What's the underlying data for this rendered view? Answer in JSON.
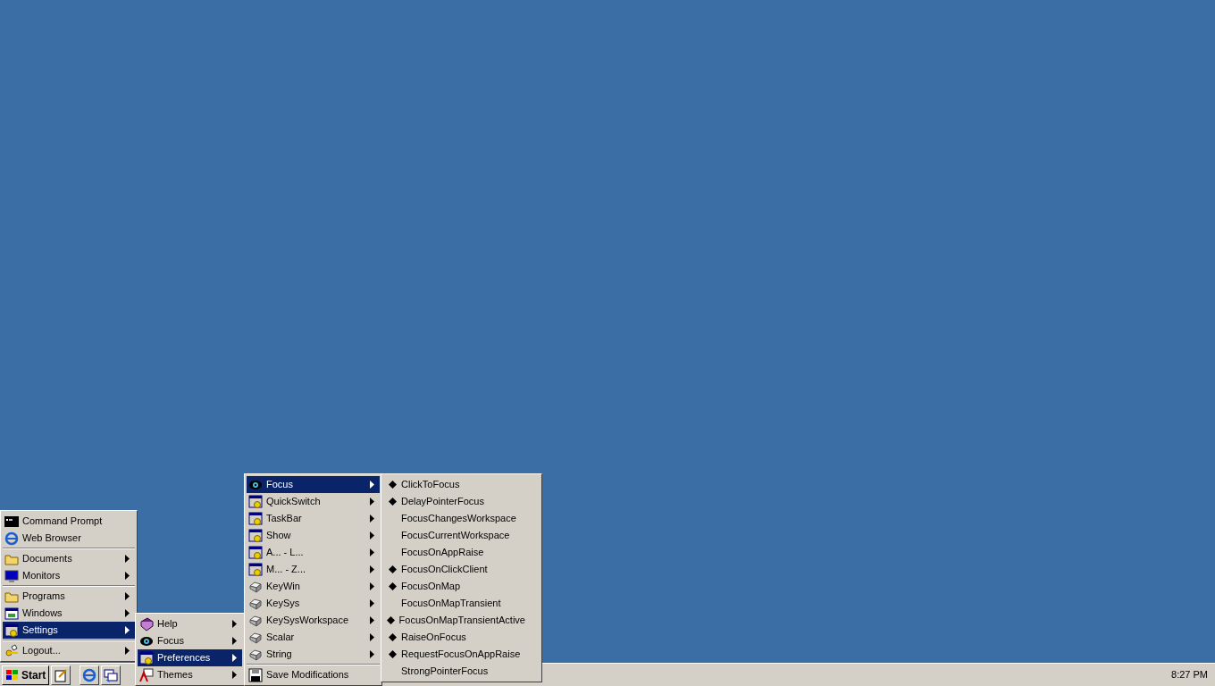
{
  "menus": [
    {
      "groups": [
        [
          {
            "label": "Command Prompt",
            "selected": false,
            "has_submenu": false
          },
          {
            "label": "Web Browser",
            "selected": false,
            "has_submenu": false
          }
        ],
        [
          {
            "label": "Documents",
            "selected": false,
            "has_submenu": true
          },
          {
            "label": "Monitors",
            "selected": false,
            "has_submenu": true
          }
        ],
        [
          {
            "label": "Programs",
            "selected": false,
            "has_submenu": true
          },
          {
            "label": "Windows",
            "selected": false,
            "has_submenu": true
          },
          {
            "label": "Settings",
            "selected": true,
            "has_submenu": true
          }
        ],
        [
          {
            "label": "Logout...",
            "selected": false,
            "has_submenu": true
          }
        ]
      ]
    },
    {
      "groups": [
        [
          {
            "label": "Help",
            "selected": false,
            "has_submenu": true
          },
          {
            "label": "Focus",
            "selected": false,
            "has_submenu": true
          },
          {
            "label": "Preferences",
            "selected": true,
            "has_submenu": true
          },
          {
            "label": "Themes",
            "selected": false,
            "has_submenu": true
          }
        ]
      ]
    },
    {
      "groups": [
        [
          {
            "label": "Focus",
            "selected": true,
            "has_submenu": true
          },
          {
            "label": "QuickSwitch",
            "selected": false,
            "has_submenu": true
          },
          {
            "label": "TaskBar",
            "selected": false,
            "has_submenu": true
          },
          {
            "label": "Show",
            "selected": false,
            "has_submenu": true
          },
          {
            "label": "A... - L...",
            "selected": false,
            "has_submenu": true
          },
          {
            "label": "M... - Z...",
            "selected": false,
            "has_submenu": true
          },
          {
            "label": "KeyWin",
            "selected": false,
            "has_submenu": true
          },
          {
            "label": "KeySys",
            "selected": false,
            "has_submenu": true
          },
          {
            "label": "KeySysWorkspace",
            "selected": false,
            "has_submenu": true
          },
          {
            "label": "Scalar",
            "selected": false,
            "has_submenu": true
          },
          {
            "label": "String",
            "selected": false,
            "has_submenu": true
          }
        ],
        [
          {
            "label": "Save Modifications",
            "selected": false,
            "has_submenu": false
          }
        ]
      ]
    },
    {
      "groups": [
        [
          {
            "label": "ClickToFocus",
            "checked": true
          },
          {
            "label": "DelayPointerFocus",
            "checked": true
          },
          {
            "label": "FocusChangesWorkspace",
            "checked": false
          },
          {
            "label": "FocusCurrentWorkspace",
            "checked": false
          },
          {
            "label": "FocusOnAppRaise",
            "checked": false
          },
          {
            "label": "FocusOnClickClient",
            "checked": true
          },
          {
            "label": "FocusOnMap",
            "checked": true
          },
          {
            "label": "FocusOnMapTransient",
            "checked": false
          },
          {
            "label": "FocusOnMapTransientActive",
            "checked": true
          },
          {
            "label": "RaiseOnFocus",
            "checked": true
          },
          {
            "label": "RequestFocusOnAppRaise",
            "checked": true
          },
          {
            "label": "StrongPointerFocus",
            "checked": false
          }
        ]
      ]
    }
  ],
  "taskbar": {
    "start_label": "Start",
    "clock": "8:27 PM"
  }
}
